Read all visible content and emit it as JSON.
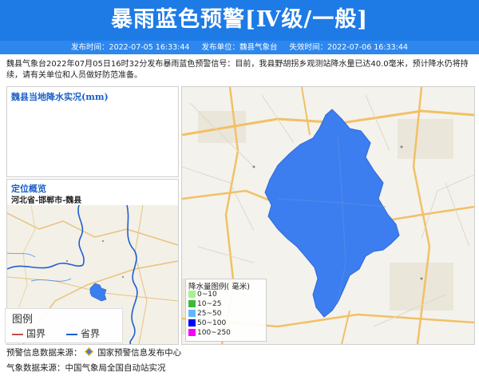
{
  "header": {
    "title": "暴雨蓝色预警[Ⅳ级/一般]",
    "publish_time": "发布时间：2022-07-05 16:33:44",
    "publish_unit": "发布单位：魏县气象台",
    "expire_time": "失效时间：2022-07-06 16:33:44"
  },
  "description": "魏县气象台2022年07月05日16时32分发布暴雨蓝色预警信号：目前，我县野胡拐乡观测站降水量已达40.0毫米，预计降水仍将持续，请有关单位和人员做好防范准备。",
  "rain_panel": {
    "title": "魏县当地降水实况(mm)"
  },
  "location_panel": {
    "title": "定位概览",
    "path": "河北省-邯郸市-魏县",
    "legend_title": "图例",
    "legend_items": [
      {
        "label": "国界",
        "color": "#c0504d"
      },
      {
        "label": "省界",
        "color": "#1f5fcf"
      }
    ]
  },
  "rain_legend": {
    "title": "降水量图例( 毫米)",
    "items": [
      {
        "label": "0~10",
        "color": "#a6f28f"
      },
      {
        "label": "10~25",
        "color": "#3dba3d"
      },
      {
        "label": "25~50",
        "color": "#61b8ff"
      },
      {
        "label": "50~100",
        "color": "#0000fe"
      },
      {
        "label": "100~250",
        "color": "#fa00fa"
      }
    ]
  },
  "footer": {
    "warning_source": "预警信息数据来源：",
    "warning_source_name": "国家预警信息发布中心",
    "weather_source": "气象数据来源：中国气象局全国自动站实况"
  },
  "colors": {
    "banner": "#1e7be6",
    "region_fill": "#3c7ef0"
  }
}
